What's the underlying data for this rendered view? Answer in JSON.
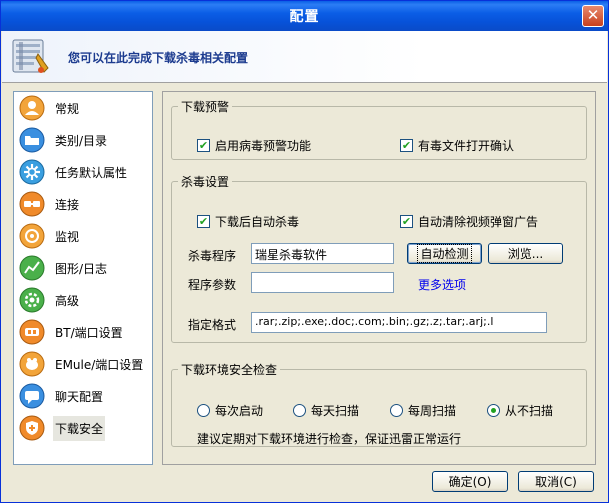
{
  "window": {
    "title": "配置",
    "close_glyph": "✕"
  },
  "banner": {
    "text": "您可以在此完成下载杀毒相关配置",
    "icon": "settings-panel-icon"
  },
  "sidebar": {
    "items": [
      {
        "label": "常规",
        "icon": "person-icon",
        "color": "#e08a1e"
      },
      {
        "label": "类别/目录",
        "icon": "folder-icon",
        "color": "#2a7fd4"
      },
      {
        "label": "任务默认属性",
        "icon": "gear-icon",
        "color": "#2a8fd4"
      },
      {
        "label": "连接",
        "icon": "connection-icon",
        "color": "#e07a1e"
      },
      {
        "label": "监视",
        "icon": "monitor-icon",
        "color": "#e08a1e"
      },
      {
        "label": "图形/日志",
        "icon": "graph-icon",
        "color": "#3aa23a"
      },
      {
        "label": "高级",
        "icon": "advanced-gear-icon",
        "color": "#3aa23a"
      },
      {
        "label": "BT/端口设置",
        "icon": "bt-icon",
        "color": "#e07a1e"
      },
      {
        "label": "EMule/端口设置",
        "icon": "emule-icon",
        "color": "#e08a1e"
      },
      {
        "label": "聊天配置",
        "icon": "chat-icon",
        "color": "#2a7fd4"
      },
      {
        "label": "下载安全",
        "icon": "shield-icon",
        "color": "#e07a1e"
      }
    ],
    "selected_index": 10
  },
  "download_warning": {
    "legend": "下载预警",
    "enable_virus_warning": {
      "label": "启用病毒预警功能",
      "checked": true
    },
    "confirm_open_infected": {
      "label": "有毒文件打开确认",
      "checked": true
    }
  },
  "antivirus": {
    "legend": "杀毒设置",
    "auto_scan_after_download": {
      "label": "下载后自动杀毒",
      "checked": true
    },
    "auto_clear_popup_ads": {
      "label": "自动清除视频弹窗广告",
      "checked": true
    },
    "program_label": "杀毒程序",
    "program_value": "瑞星杀毒软件",
    "auto_detect_label": "自动检测",
    "browse_label": "浏览...",
    "params_label": "程序参数",
    "params_value": "",
    "more_options_label": "更多选项",
    "format_label": "指定格式",
    "format_value": ".rar;.zip;.exe;.doc;.com;.bin;.gz;.z;.tar;.arj;.l"
  },
  "env_check": {
    "legend": "下载环境安全检查",
    "options": [
      {
        "label": "每次启动",
        "selected": false
      },
      {
        "label": "每天扫描",
        "selected": false
      },
      {
        "label": "每周扫描",
        "selected": false
      },
      {
        "label": "从不扫描",
        "selected": true
      }
    ],
    "note": "建议定期对下载环境进行检查，保证迅雷正常运行"
  },
  "footer": {
    "ok_label": "确定(O)",
    "cancel_label": "取消(C)"
  }
}
